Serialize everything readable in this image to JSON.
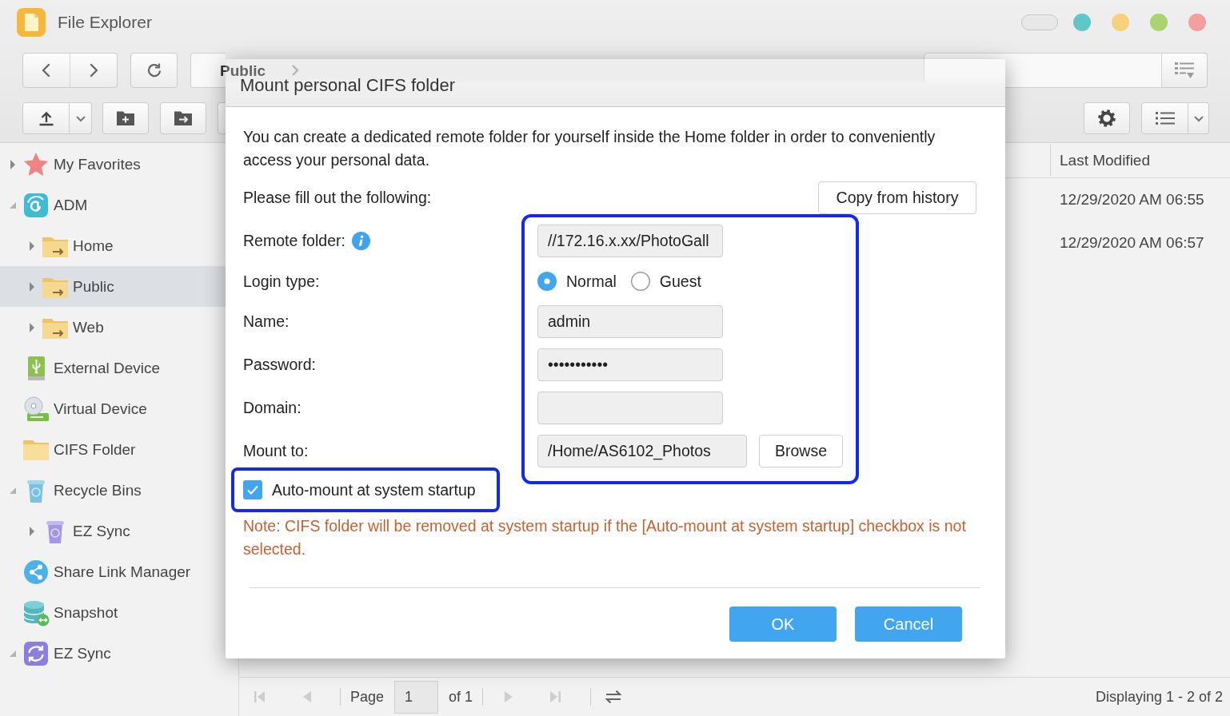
{
  "window": {
    "title": "File Explorer",
    "controls": [
      {
        "kind": "pill"
      },
      {
        "kind": "dot",
        "color": "#62c6c9"
      },
      {
        "kind": "dot",
        "color": "#f6d27c"
      },
      {
        "kind": "dot",
        "color": "#a9d46f"
      },
      {
        "kind": "dot",
        "color": "#f49ea0"
      }
    ]
  },
  "address_bar": {
    "path": "Public"
  },
  "sidebar": {
    "items": [
      {
        "label": "My Favorites",
        "kind": "star",
        "expanded": false,
        "selected": false
      },
      {
        "label": "ADM",
        "kind": "app-tile",
        "expanded": true,
        "selected": false,
        "children": [
          {
            "label": "Home",
            "kind": "share-folder",
            "expanded": false,
            "selected": false
          },
          {
            "label": "Public",
            "kind": "share-folder",
            "expanded": false,
            "selected": true
          },
          {
            "label": "Web",
            "kind": "share-folder",
            "expanded": false,
            "selected": false
          }
        ]
      },
      {
        "label": "External Device",
        "kind": "usb-drive",
        "selected": false
      },
      {
        "label": "Virtual Device",
        "kind": "disc-drive",
        "selected": false
      },
      {
        "label": "CIFS Folder",
        "kind": "folder",
        "selected": false
      },
      {
        "label": "Recycle Bins",
        "kind": "recycle-bin",
        "expanded": true,
        "selected": false,
        "children": [
          {
            "label": "EZ Sync",
            "kind": "sync-bin",
            "expanded": false,
            "selected": false
          }
        ]
      },
      {
        "label": "Share Link Manager",
        "kind": "share",
        "selected": false
      },
      {
        "label": "Snapshot",
        "kind": "database",
        "selected": false
      },
      {
        "label": "EZ Sync",
        "kind": "sync",
        "expanded": true,
        "selected": false
      }
    ]
  },
  "table": {
    "columns": [
      {
        "label": "Last Modified"
      }
    ],
    "rows": [
      {
        "cells": [
          "12/29/2020 AM 06:55"
        ]
      },
      {
        "cells": [
          "12/29/2020 AM 06:57"
        ]
      }
    ]
  },
  "pager": {
    "nav": [
      {
        "kind": "first",
        "disabled": true
      },
      {
        "kind": "previous",
        "disabled": true
      },
      {
        "kind": "next",
        "disabled": true
      },
      {
        "kind": "last",
        "disabled": true
      }
    ],
    "page_label": "Page",
    "page": "1",
    "total": "of 1",
    "summary": "Displaying 1 - 2 of 2"
  },
  "dialog": {
    "title": "Mount personal CIFS folder",
    "intro": "You can create a dedicated remote folder for yourself inside the Home folder in order to conveniently access your personal data.",
    "prompt": "Please fill out the following:",
    "history_button": "Copy from history",
    "form": {
      "highlighted": true,
      "fields": [
        {
          "kind": "text",
          "label": "Remote folder:",
          "info": true,
          "value": "//172.16.x.xx/PhotoGall"
        },
        {
          "kind": "radio",
          "label": "Login type:",
          "options": [
            {
              "label": "Normal",
              "selected": true
            },
            {
              "label": "Guest",
              "selected": false
            }
          ]
        },
        {
          "kind": "text",
          "label": "Name:",
          "value": "admin"
        },
        {
          "kind": "password",
          "label": "Password:",
          "value": "•••••••••••"
        },
        {
          "kind": "text",
          "label": "Domain:"
        },
        {
          "kind": "path",
          "label": "Mount to:",
          "value": "/Home/AS6102_Photos",
          "button": "Browse"
        }
      ]
    },
    "auto_mount": {
      "label": "Auto-mount at system startup",
      "checked": true,
      "highlighted": true
    },
    "note": "Note: CIFS folder will be removed at system startup if the [Auto-mount at system startup] checkbox is not selected.",
    "buttons": [
      "OK",
      "Cancel"
    ]
  }
}
